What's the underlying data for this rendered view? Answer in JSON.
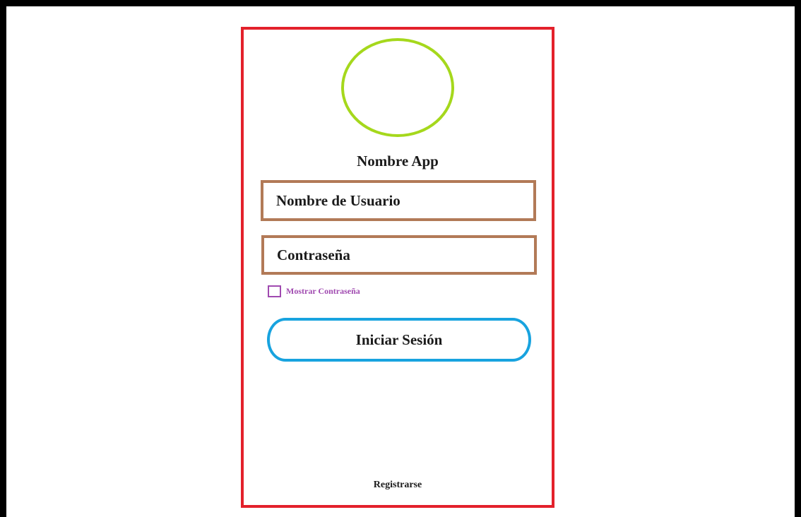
{
  "app": {
    "name": "Nombre App"
  },
  "login_form": {
    "username_value": "Nombre de Usuario",
    "password_value": "Contraseña",
    "show_password_label": "Mostrar Contraseña",
    "show_password_checked": false,
    "submit_label": "Iniciar Sesión"
  },
  "footer": {
    "register_label": "Registrarse"
  },
  "colors": {
    "frame_border": "#000000",
    "phone_border": "#e3212b",
    "logo_circle": "#a5d81c",
    "field_border": "#b27a57",
    "checkbox": "#a04ab0",
    "button_border": "#18a3df"
  },
  "icons": {
    "logo": "logo-placeholder-icon",
    "show_password_checkbox": "checkbox-unchecked-icon"
  }
}
